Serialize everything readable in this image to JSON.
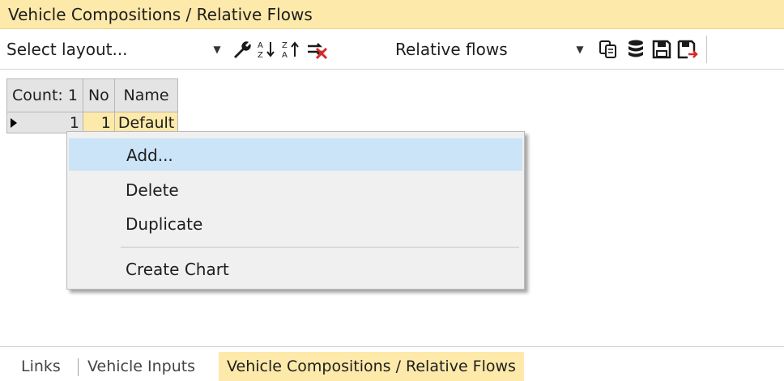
{
  "window": {
    "title": "Vehicle Compositions / Relative Flows"
  },
  "toolbar": {
    "layout_select": {
      "value": "Select layout..."
    },
    "view_select": {
      "value": "Relative flows"
    },
    "icons": [
      "wrench-icon",
      "sort-ascending-icon",
      "sort-descending-icon",
      "remove-sort-icon",
      "copy-icon",
      "database-icon",
      "save-icon",
      "save-as-icon"
    ]
  },
  "grid": {
    "headers": {
      "count": "Count: 1",
      "no": "No",
      "name": "Name"
    },
    "rows": [
      {
        "index": "1",
        "no": "1",
        "name": "Default"
      }
    ]
  },
  "context_menu": {
    "items": [
      "Add...",
      "Delete",
      "Duplicate",
      "Create Chart"
    ],
    "highlighted": "Add..."
  },
  "tabs": [
    "Links",
    "Vehicle Inputs",
    "Vehicle Compositions / Relative Flows"
  ],
  "active_tab": "Vehicle Compositions / Relative Flows",
  "colors": {
    "accent": "#fde9a9",
    "menu_highlight": "#cce4f7",
    "menu_bg": "#f0f0f0"
  }
}
